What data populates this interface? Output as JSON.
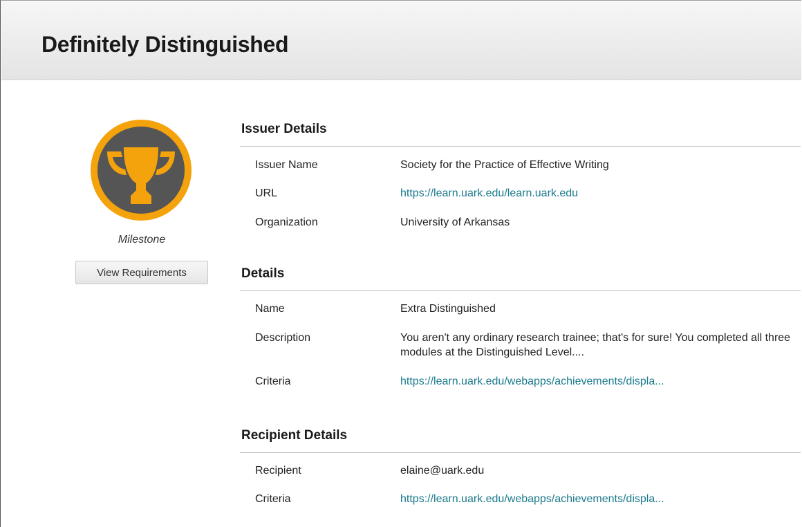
{
  "page": {
    "title": "Definitely Distinguished"
  },
  "badge": {
    "icon": "trophy-icon",
    "ring_color": "#f4a30c",
    "inner_color": "#555555",
    "type_label": "Milestone",
    "view_button_label": "View Requirements"
  },
  "issuer": {
    "heading": "Issuer Details",
    "name_label": "Issuer Name",
    "name_value": "Society for the Practice of Effective Writing",
    "url_label": "URL",
    "url_value": "https://learn.uark.edu/learn.uark.edu",
    "org_label": "Organization",
    "org_value": "University of Arkansas"
  },
  "details": {
    "heading": "Details",
    "name_label": "Name",
    "name_value": "Extra Distinguished",
    "description_label": "Description",
    "description_value": "You aren't any ordinary research trainee; that's for sure!  You completed all three modules at the Distinguished Level....",
    "criteria_label": "Criteria",
    "criteria_value": "https://learn.uark.edu/webapps/achievements/displa..."
  },
  "recipient": {
    "heading": "Recipient Details",
    "recipient_label": "Recipient",
    "recipient_value": "elaine@uark.edu",
    "criteria_label": "Criteria",
    "criteria_value": "https://learn.uark.edu/webapps/achievements/displa..."
  },
  "colors": {
    "link": "#1a7a8c",
    "badge_ring": "#f4a30c",
    "badge_inner": "#555555"
  }
}
